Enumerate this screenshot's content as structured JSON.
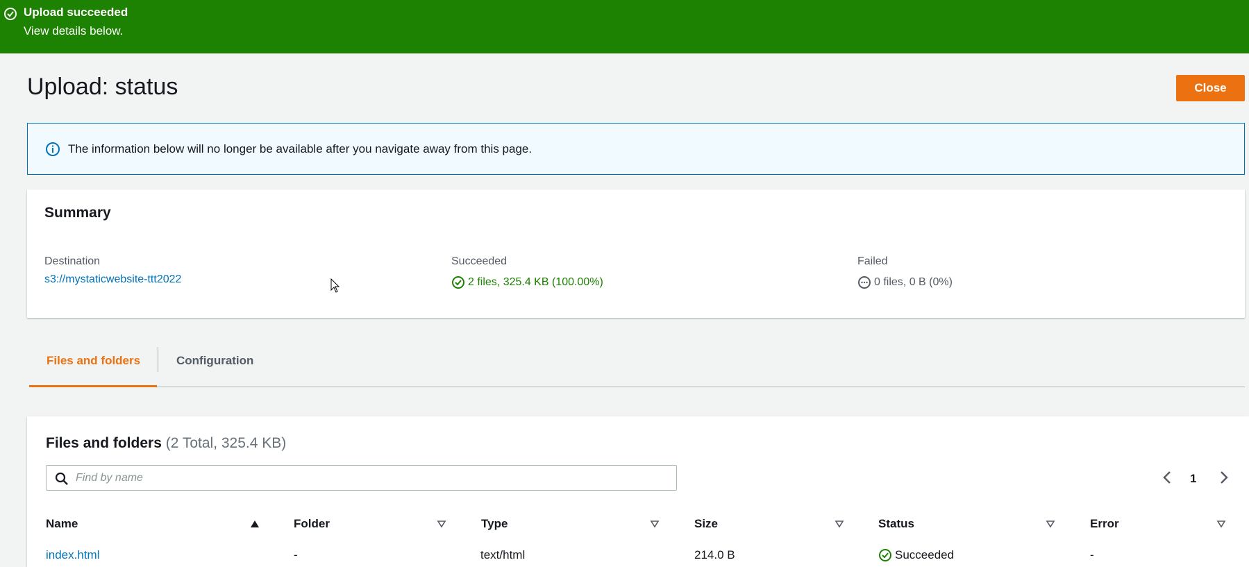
{
  "flash": {
    "title": "Upload succeeded",
    "subtitle": "View details below.",
    "color": "#1d8102"
  },
  "header": {
    "title": "Upload: status",
    "close_label": "Close",
    "accent": "#ec7211"
  },
  "info_alert": {
    "text": "The information below will no longer be available after you navigate away from this page.",
    "icon": "info-icon"
  },
  "summary": {
    "title": "Summary",
    "destination": {
      "label": "Destination",
      "value": "s3://mystaticwebsite-ttt2022"
    },
    "succeeded": {
      "label": "Succeeded",
      "value": "2 files, 325.4 KB (100.00%)",
      "icon": "check-circle-icon"
    },
    "failed": {
      "label": "Failed",
      "value": "0 files, 0 B (0%)",
      "icon": "ellipsis-circle-icon"
    }
  },
  "tabs": [
    {
      "label": "Files and folders",
      "active": true
    },
    {
      "label": "Configuration",
      "active": false
    }
  ],
  "files": {
    "title": "Files and folders",
    "count": "(2 Total, 325.4 KB)",
    "search_placeholder": "Find by name",
    "page": "1",
    "columns": [
      "Name",
      "Folder",
      "Type",
      "Size",
      "Status",
      "Error"
    ],
    "rows": [
      {
        "name": "index.html",
        "folder": "-",
        "type": "text/html",
        "size": "214.0 B",
        "status": "Succeeded",
        "error": "-"
      }
    ]
  }
}
